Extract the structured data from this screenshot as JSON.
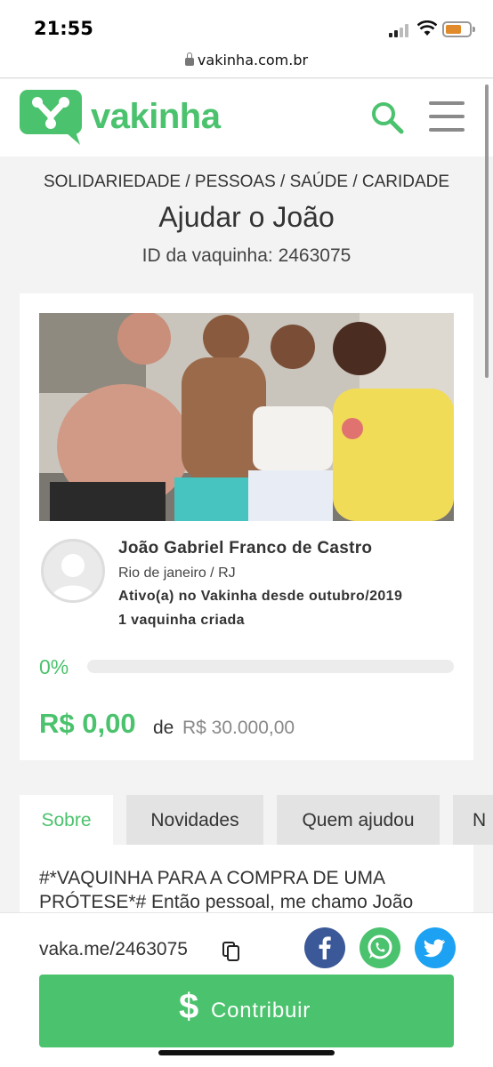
{
  "status_bar": {
    "time": "21:55"
  },
  "browser": {
    "url": "vakinha.com.br"
  },
  "header": {
    "brand": "vakinha",
    "brand_color": "#4bc26d"
  },
  "campaign": {
    "breadcrumb": "SOLIDARIEDADE / PESSOAS / SAÚDE / CARIDADE",
    "title": "Ajudar o João",
    "id_label": "ID da vaquinha: 2463075"
  },
  "owner": {
    "name": "João Gabriel Franco de Castro",
    "location": "Rio de janeiro / RJ",
    "member_since": "Ativo(a) no Vakinha desde outubro/2019",
    "campaigns_created": "1 vaquinha criada"
  },
  "progress": {
    "percent_label": "0%",
    "fraction": 0,
    "raised": "R$ 0,00",
    "of_label": "de",
    "goal": "R$ 30.000,00"
  },
  "tabs": [
    {
      "label": "Sobre",
      "active": true
    },
    {
      "label": "Novidades",
      "active": false
    },
    {
      "label": "Quem ajudou",
      "active": false
    },
    {
      "label": "N",
      "active": false
    }
  ],
  "description": "#*VAQUINHA PARA A COMPRA DE UMA PRÓTESE*# Então pessoal, me chamo João",
  "share": {
    "short_link": "vaka.me/2463075",
    "social": [
      {
        "name": "facebook-icon",
        "glyph": "f",
        "color": "#3b5998"
      },
      {
        "name": "whatsapp-icon",
        "glyph": "",
        "color": "#4bc26d"
      },
      {
        "name": "twitter-icon",
        "glyph": "",
        "color": "#1da1f2"
      }
    ]
  },
  "cta": {
    "dollar": "$",
    "label": "Contribuir"
  }
}
